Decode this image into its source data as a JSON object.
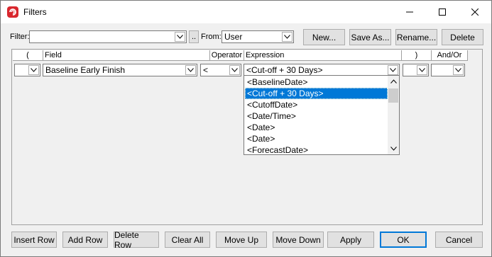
{
  "window": {
    "title": "Filters"
  },
  "toolbar": {
    "filter_label": "Filter:",
    "filter_value": "",
    "dots_label": "..",
    "from_label": "From:",
    "from_value": "User",
    "new_label": "New...",
    "save_as_label": "Save As...",
    "rename_label": "Rename...",
    "delete_label": "Delete"
  },
  "grid": {
    "columns": [
      "(",
      "Field",
      "Operator",
      "Expression",
      ")",
      "And/Or"
    ],
    "row": {
      "open_paren": "",
      "field": "Baseline Early Finish",
      "operator": "<",
      "expression": "<Cut-off + 30 Days>",
      "close_paren": "",
      "and_or": ""
    }
  },
  "expression_dropdown": {
    "options": [
      "<BaselineDate>",
      "<Cut-off + 30 Days>",
      "<CutoffDate>",
      "<Date/Time>",
      "<Date>",
      "<Date>",
      "<ForecastDate>"
    ],
    "selected_index": 1
  },
  "footer": {
    "insert_row": "Insert Row",
    "add_row": "Add Row",
    "delete_row": "Delete Row",
    "clear_all": "Clear All",
    "move_up": "Move Up",
    "move_down": "Move Down",
    "apply": "Apply",
    "ok": "OK",
    "cancel": "Cancel"
  },
  "colors": {
    "accent": "#0078d7",
    "app_icon": "#d9272e"
  }
}
